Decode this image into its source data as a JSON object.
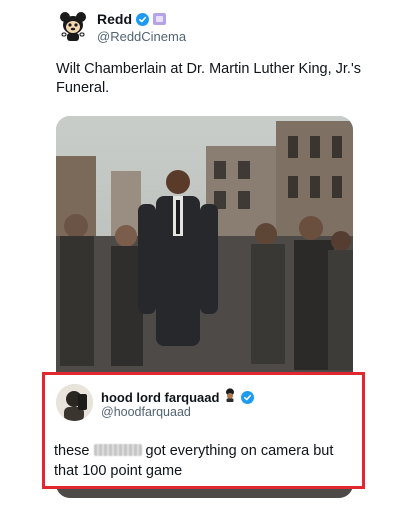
{
  "post": {
    "author_name": "Redd",
    "author_handle": "@ReddCinema",
    "text": "Wilt Chamberlain at Dr. Martin Luther King, Jr.'s Funeral."
  },
  "reply": {
    "author_name": "hood lord farquaad",
    "author_handle": "@hoodfarquaad",
    "text_before": "these",
    "text_after": "got everything on camera but that 100 point game"
  },
  "icons": {
    "main_avatar": "cartoon-character-avatar",
    "verified": "verified-badge-icon",
    "affiliate": "affiliate-badge-icon",
    "emoji": "guard-emoji",
    "photo": "historical-funeral-photo"
  },
  "colors": {
    "verified": "#1d9bf0",
    "highlight_border": "#e2282f",
    "handle_gray": "#536471"
  }
}
